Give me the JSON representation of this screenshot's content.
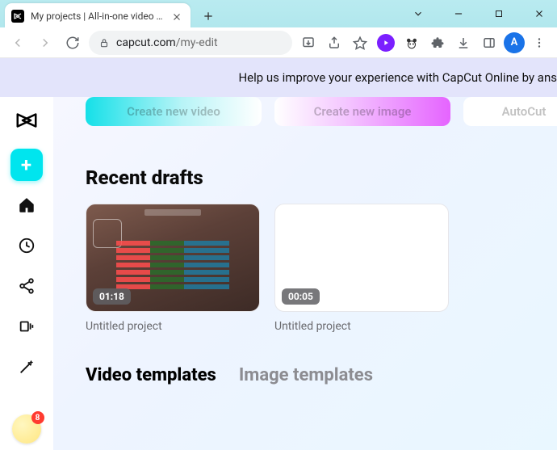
{
  "browser": {
    "tab_title": "My projects | All-in-one video ed",
    "url_host": "capcut.com",
    "url_path": "/my-edit",
    "avatar_letter": "A"
  },
  "banner": {
    "text": "Help us improve your experience with CapCut Online by ans"
  },
  "sidebar": {
    "notification_count": "8"
  },
  "create_row": {
    "video_label": "Create new video",
    "image_label": "Create new image",
    "autocut_label": "AutoCut"
  },
  "sections": {
    "recent_drafts": "Recent drafts",
    "video_templates": "Video templates",
    "image_templates": "Image templates"
  },
  "drafts": [
    {
      "duration": "01:18",
      "title": "Untitled project"
    },
    {
      "duration": "00:05",
      "title": "Untitled project"
    }
  ]
}
